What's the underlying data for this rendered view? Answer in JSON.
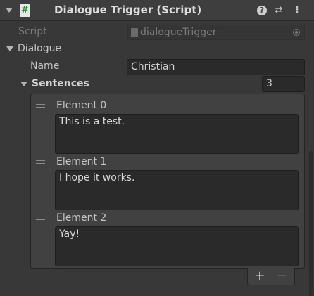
{
  "header": {
    "icon_glyph": "#",
    "title": "Dialogue Trigger (Script)",
    "help_glyph": "?",
    "presets_glyph": "⇄",
    "menu_glyph": "⋮"
  },
  "script_field": {
    "label": "Script",
    "value": "dialogueTrigger"
  },
  "dialogue": {
    "label": "Dialogue",
    "name_label": "Name",
    "name_value": "Christian",
    "sentences": {
      "label": "Sentences",
      "size": "3",
      "elements": [
        {
          "label": "Element 0",
          "value": "This is a test."
        },
        {
          "label": "Element 1",
          "value": "I hope it works."
        },
        {
          "label": "Element 2",
          "value": "Yay!"
        }
      ],
      "add_label": "+",
      "remove_label": "−"
    }
  },
  "colors": {
    "background": "#383838",
    "header": "#3e3e3e",
    "field": "#2a2a2a",
    "text": "#c4c4c4",
    "script_icon_green": "#2c8a3a"
  }
}
